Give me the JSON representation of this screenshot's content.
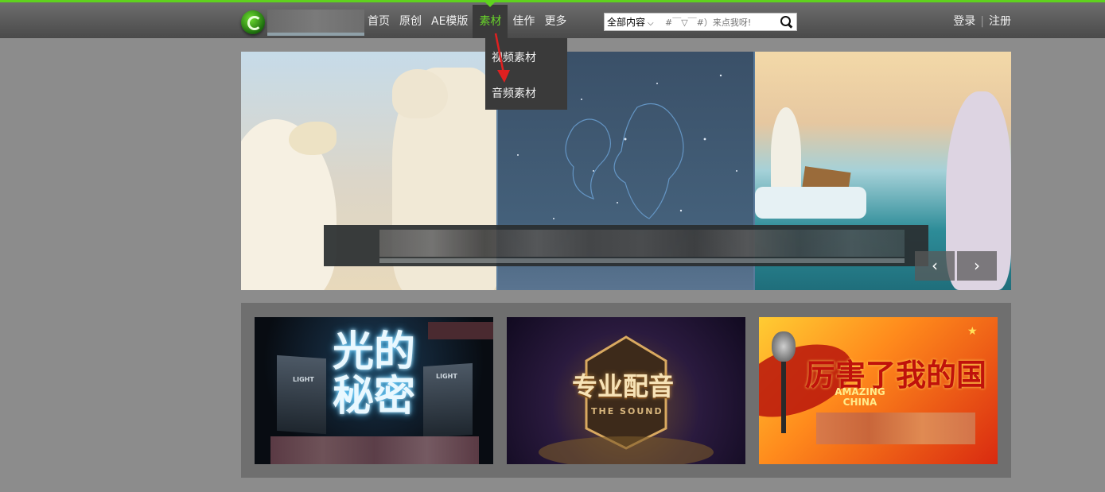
{
  "header": {
    "nav": [
      {
        "label": "首页"
      },
      {
        "label": "原创"
      },
      {
        "label": "AE模版"
      },
      {
        "label": "素材",
        "active": true
      },
      {
        "label": "佳作"
      },
      {
        "label": "更多"
      }
    ],
    "search": {
      "scope": "全部内容",
      "placeholder": "#￣▽￣#）来点我呀!"
    },
    "auth": {
      "login": "登录",
      "separator": "|",
      "register": "注册"
    }
  },
  "dropdown": {
    "items": [
      {
        "label": "视频素材"
      },
      {
        "label": "音频素材"
      }
    ]
  },
  "banner": {
    "prev": "‹",
    "next": "›"
  },
  "cards": [
    {
      "title": "光的秘密",
      "badges": [
        "LIGHT",
        "LIGHT"
      ]
    },
    {
      "title": "专业配音",
      "subtitle": "THE SOUND"
    },
    {
      "title": "厉害了我的国",
      "subtitle": "AMAZING CHINA"
    }
  ],
  "colors": {
    "accent": "#5fd21e",
    "topbar": "#555555",
    "background": "#8c8c8c"
  }
}
